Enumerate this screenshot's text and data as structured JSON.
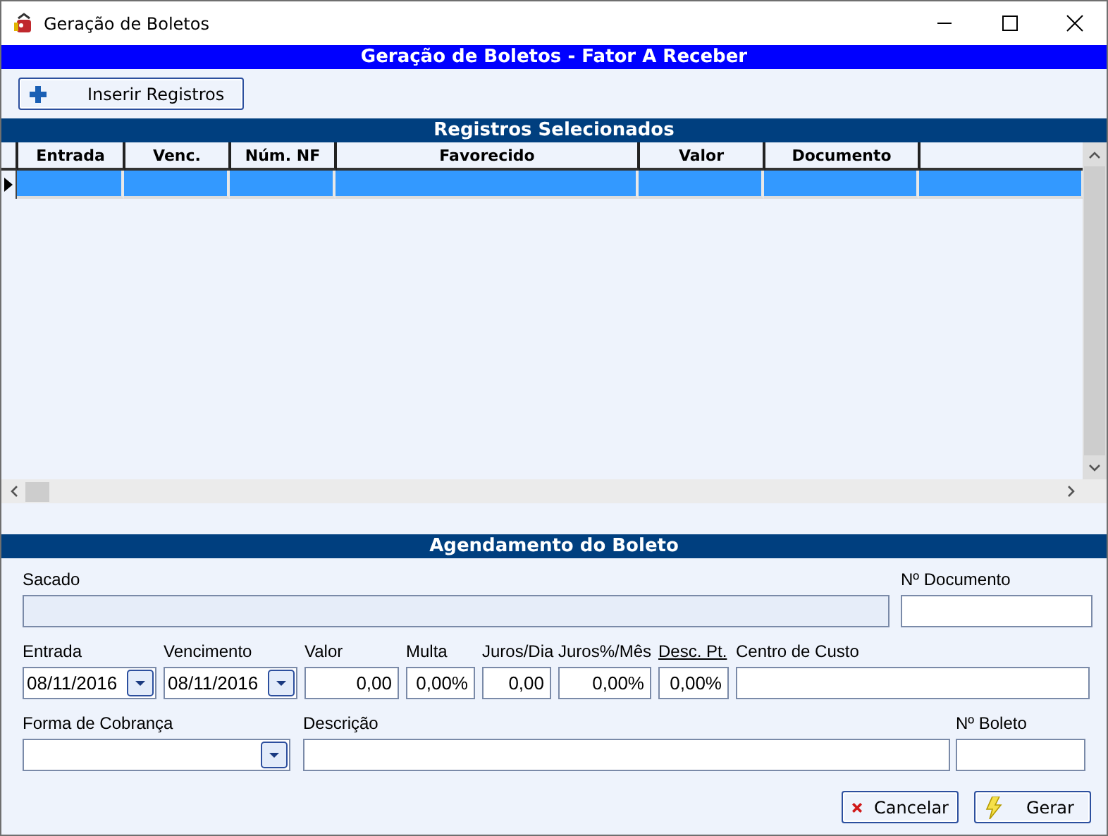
{
  "window": {
    "title": "Geração de Boletos"
  },
  "banner": "Geração de Boletos - Fator A Receber",
  "toolbar": {
    "button": "Inserir Registros"
  },
  "grid_section": "Registros Selecionados",
  "table": {
    "columns": [
      "Entrada",
      "Venc.",
      "Núm. NF",
      "Favorecido",
      "Valor",
      "Documento"
    ],
    "rows": [
      {
        "selected": true,
        "current": true
      }
    ]
  },
  "form_section": "Agendamento do Boleto",
  "form_rows": [
    [
      {
        "label": "Sacado",
        "kind": "text",
        "disabled": true,
        "underlined": false
      },
      {
        "label": "Nº Documento",
        "kind": "text",
        "disabled": false,
        "underlined": false
      }
    ],
    [
      {
        "label": "Entrada",
        "kind": "date",
        "value": "08/11/2016",
        "disabled": false,
        "underlined": false
      },
      {
        "label": "Vencimento",
        "kind": "date",
        "value": "08/11/2016",
        "disabled": false,
        "underlined": false
      },
      {
        "label": "Valor",
        "kind": "number",
        "value": "0,00",
        "disabled": false,
        "underlined": false
      },
      {
        "label": "Multa",
        "kind": "number",
        "value": "0,00%",
        "disabled": false,
        "underlined": false
      },
      {
        "label": "Juros/Dia",
        "kind": "number",
        "value": "0,00",
        "disabled": false,
        "underlined": false
      },
      {
        "label": "Juros%/Mês",
        "kind": "number",
        "value": "0,00%",
        "disabled": false,
        "underlined": false
      },
      {
        "label": "Desc. Pt.",
        "kind": "number",
        "value": "0,00%",
        "disabled": false,
        "underlined": true
      },
      {
        "label": "Centro de Custo",
        "kind": "text",
        "disabled": false,
        "underlined": false
      }
    ],
    [
      {
        "label": "Forma de Cobrança",
        "kind": "combo",
        "disabled": false,
        "underlined": false
      },
      {
        "label": "Descrição",
        "kind": "text",
        "disabled": false,
        "underlined": false
      },
      {
        "label": "Nº Boleto",
        "kind": "text",
        "disabled": false,
        "underlined": false
      }
    ]
  ],
  "buttons": [
    {
      "kind": "cancel",
      "label": "Cancelar"
    },
    {
      "kind": "generate",
      "label": "Gerar"
    }
  ]
}
